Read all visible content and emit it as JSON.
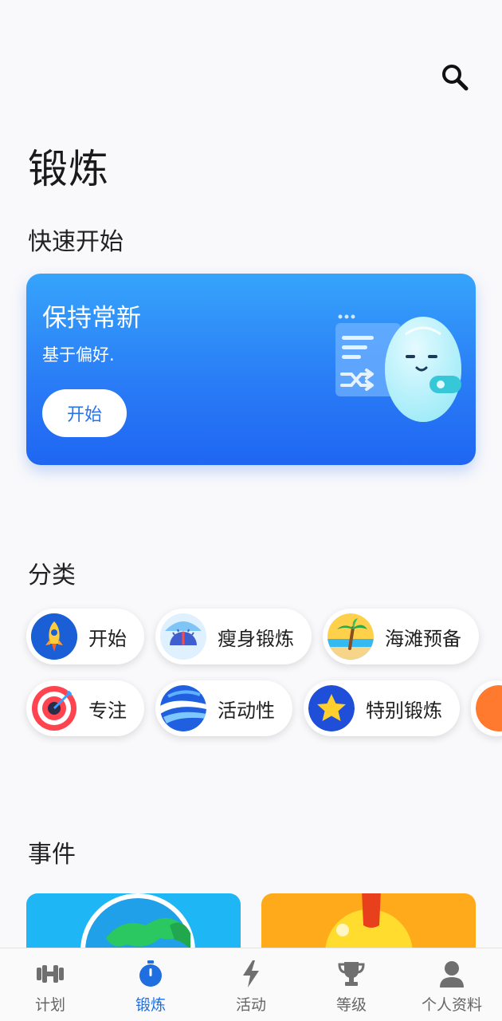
{
  "header": {
    "page_title": "锻炼"
  },
  "quick_start": {
    "section_title": "快速开始",
    "card": {
      "title": "保持常新",
      "subtitle": "基于偏好.",
      "button_label": "开始"
    }
  },
  "categories": {
    "section_title": "分类",
    "row1": [
      {
        "label": "开始",
        "icon": "rocket-icon"
      },
      {
        "label": "瘦身锻炼",
        "icon": "scale-icon"
      },
      {
        "label": "海滩预备",
        "icon": "beach-icon"
      }
    ],
    "row2": [
      {
        "label": "专注",
        "icon": "target-icon"
      },
      {
        "label": "活动性",
        "icon": "wave-icon"
      },
      {
        "label": "特别锻炼",
        "icon": "star-icon"
      }
    ]
  },
  "events": {
    "section_title": "事件"
  },
  "bottom_nav": {
    "items": [
      {
        "label": "计划",
        "icon": "dumbbell-icon",
        "active": false
      },
      {
        "label": "锻炼",
        "icon": "stopwatch-icon",
        "active": true
      },
      {
        "label": "活动",
        "icon": "lightning-icon",
        "active": false
      },
      {
        "label": "等级",
        "icon": "trophy-icon",
        "active": false
      },
      {
        "label": "个人资料",
        "icon": "person-icon",
        "active": false
      }
    ]
  },
  "colors": {
    "accent": "#1f6fe0",
    "card_blue": "#2a7df6",
    "background": "#f9f9fb"
  }
}
